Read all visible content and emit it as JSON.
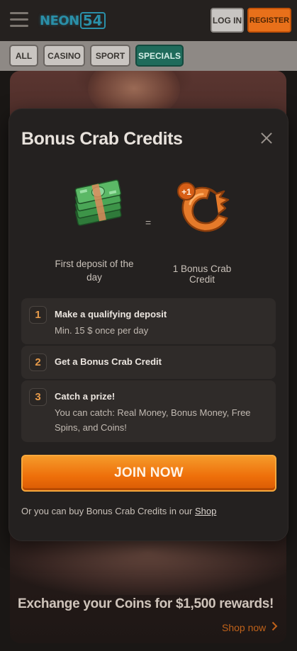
{
  "header": {
    "logo_text": "NEON",
    "logo_number": "54",
    "login_label": "LOG IN",
    "register_label": "REGISTER"
  },
  "tabs": [
    {
      "label": "ALL",
      "active": false
    },
    {
      "label": "CASINO",
      "active": false
    },
    {
      "label": "SPORT",
      "active": false
    },
    {
      "label": "SPECIALS",
      "active": true
    }
  ],
  "modal": {
    "title": "Bonus Crab Credits",
    "left_caption": "First deposit of the day",
    "equals": "=",
    "crab_badge": "+1",
    "right_caption": "1 Bonus Crab Credit",
    "steps": [
      {
        "number": "1",
        "title": "Make a qualifying deposit",
        "description": "Min. 15 $ once per day"
      },
      {
        "number": "2",
        "title": "Get a Bonus Crab Credit",
        "description": ""
      },
      {
        "number": "3",
        "title": "Catch a prize!",
        "description": "You can catch: Real Money, Bonus Money, Free Spins, and Coins!"
      }
    ],
    "join_label": "JOIN NOW",
    "footer_text": "Or you can buy Bonus Crab Credits in our",
    "footer_link": "Shop"
  },
  "background": {
    "promo_title": "Exchange your Coins for $1,500 rewards!",
    "shop_now": "Shop now"
  },
  "colors": {
    "accent_orange": "#ee6f0a",
    "active_tab": "#1f6b5b",
    "logo_teal": "#2a8fa8"
  },
  "icons": [
    "menu-icon",
    "money-stack-icon",
    "crab-credit-icon",
    "close-icon",
    "chevron-right-icon"
  ]
}
